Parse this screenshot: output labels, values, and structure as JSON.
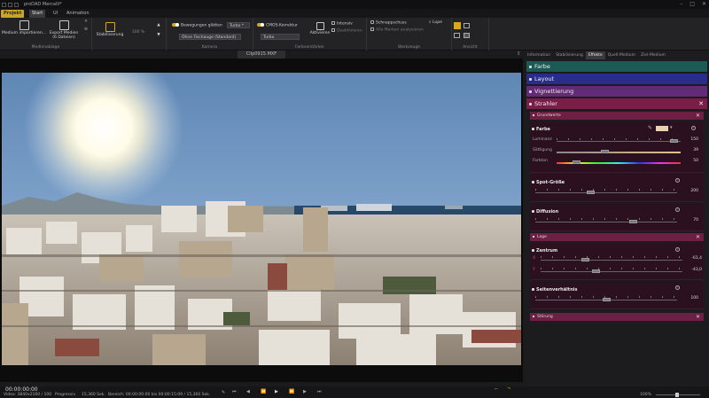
{
  "window": {
    "title": "proDAD Mercalli*"
  },
  "tabs": {
    "projekt": "Projekt",
    "start": "Start",
    "ui": "UI",
    "animation": "Animation"
  },
  "ribbon": {
    "medium_importieren": "Medium importieren...",
    "export_medien": "Export Medien",
    "export_count": "(6 Dateien)",
    "zielablage": "Zielablage",
    "medienablage": "Medienablage",
    "stabilisierung": "Stabilisierung",
    "zoom_value": "100 %",
    "bewegungen_glaetten": "Bewegungen glätten",
    "turbo1": "Turbo *",
    "ohne_fischauge": "Ohne Fischauge (Standard)",
    "kamera": "Kamera",
    "cmos_korrektur": "CMOS-Korrektur",
    "turbo2": "Turbo",
    "aktivieren": "Aktivieren",
    "intensiv": "Intensiv",
    "deaktivieren": "Deaktivieren",
    "farbverstaerker": "Farbverstärker",
    "schnappschuss": "Schnappschuss",
    "alle_marken": "Alle Marken analysieren",
    "lupe": "Lupe",
    "werkzeuge": "Werkzeuge",
    "ansicht": "Ansicht"
  },
  "viewer": {
    "filename": "Clip0915.MXF"
  },
  "status": {
    "timecode": "00:00:00:00",
    "video": "Video: 3840x2160 / 100",
    "progressiv": "Progressiv",
    "duration": "15,360 Sek.",
    "bereich": "Bereich: 00:00:00:00 bis 00:00:15:09 / 15,360 Sek.",
    "zoom": "100%"
  },
  "panel": {
    "tabs": [
      "Information",
      "Stabilisierung",
      "Effekte",
      "Quell-Medium",
      "Ziel-Medium"
    ],
    "active_tab": "Effekte",
    "sections": {
      "farbe": "Farbe",
      "layout": "Layout",
      "vignettierung": "Vignettierung",
      "strahler": "Strahler"
    },
    "grundwerte": "Grundwerte",
    "farbe_box": {
      "title": "Farbe",
      "luminanz_label": "Luminanz",
      "luminanz": "150",
      "saettigung_label": "Sättigung",
      "saettigung": "39",
      "farbton_label": "Farbton",
      "farbton": "50",
      "swatch_color": "#e9d2b0"
    },
    "spot_groesse": {
      "title": "Spot-Größe",
      "value": "200"
    },
    "diffusion": {
      "title": "Diffusion",
      "value": "70"
    },
    "lage": "Lage",
    "zentrum": {
      "title": "Zentrum",
      "x_label": "X",
      "x": "-61,4",
      "y_label": "Y",
      "y": "-43,0"
    },
    "seitenverhaeltnis": {
      "title": "Seitenverhältnis",
      "value": "100"
    },
    "stoerung": "Störung"
  },
  "colors": {
    "section_farbe": "#1c5a56",
    "section_layout": "#2b2b8c",
    "section_vignettierung": "#642a78",
    "section_strahler": "#7a1e48",
    "accent": "#d6a81e"
  }
}
